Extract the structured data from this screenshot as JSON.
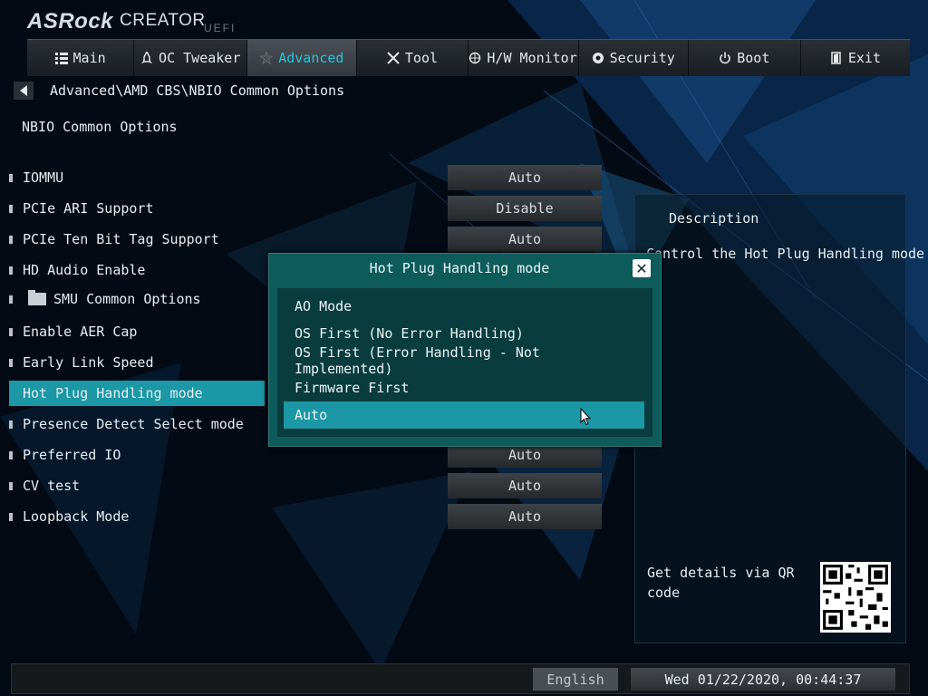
{
  "logo": {
    "brand": "ASRock",
    "product": "CREATOR",
    "firmware": "UEFI"
  },
  "tabs": [
    {
      "label": "Main",
      "icon": "list-icon"
    },
    {
      "label": "OC Tweaker",
      "icon": "rocket-icon"
    },
    {
      "label": "Advanced",
      "icon": "star-icon",
      "active": true
    },
    {
      "label": "Tool",
      "icon": "tools-icon"
    },
    {
      "label": "H/W Monitor",
      "icon": "monitor-icon"
    },
    {
      "label": "Security",
      "icon": "shield-icon"
    },
    {
      "label": "Boot",
      "icon": "power-icon"
    },
    {
      "label": "Exit",
      "icon": "exit-icon"
    }
  ],
  "breadcrumb": "Advanced\\AMD CBS\\NBIO Common Options",
  "page_title": "NBIO Common Options",
  "settings": [
    {
      "label": "IOMMU",
      "value": "Auto"
    },
    {
      "label": "PCIe ARI Support",
      "value": "Disable"
    },
    {
      "label": "PCIe Ten Bit Tag Support",
      "value": "Auto"
    },
    {
      "label": "HD Audio Enable",
      "value": ""
    },
    {
      "label": "SMU Common Options",
      "value": ""
    },
    {
      "label": "Enable AER Cap",
      "value": ""
    },
    {
      "label": "Early Link Speed",
      "value": ""
    },
    {
      "label": "Hot Plug Handling mode",
      "value": ""
    },
    {
      "label": "Presence Detect Select mode",
      "value": ""
    },
    {
      "label": "Preferred IO",
      "value": "Auto"
    },
    {
      "label": "CV test",
      "value": "Auto"
    },
    {
      "label": "Loopback Mode",
      "value": "Auto"
    }
  ],
  "description": {
    "title": "Description",
    "text": "Control the Hot Plug Handling mode",
    "qr_label": "Get details via QR code"
  },
  "dialog": {
    "title": "Hot Plug Handling mode",
    "options": [
      "AO Mode",
      "OS First (No Error Handling)",
      "OS First (Error Handling - Not Implemented)",
      "Firmware First",
      "Auto"
    ],
    "selected": "Auto"
  },
  "status_bar": {
    "language": "English",
    "datetime": "Wed 01/22/2020, 00:44:37"
  },
  "colors": {
    "accent": "#1fc6de",
    "selection": "#1b97a5",
    "dialog_bg": "#0e5b5c"
  }
}
